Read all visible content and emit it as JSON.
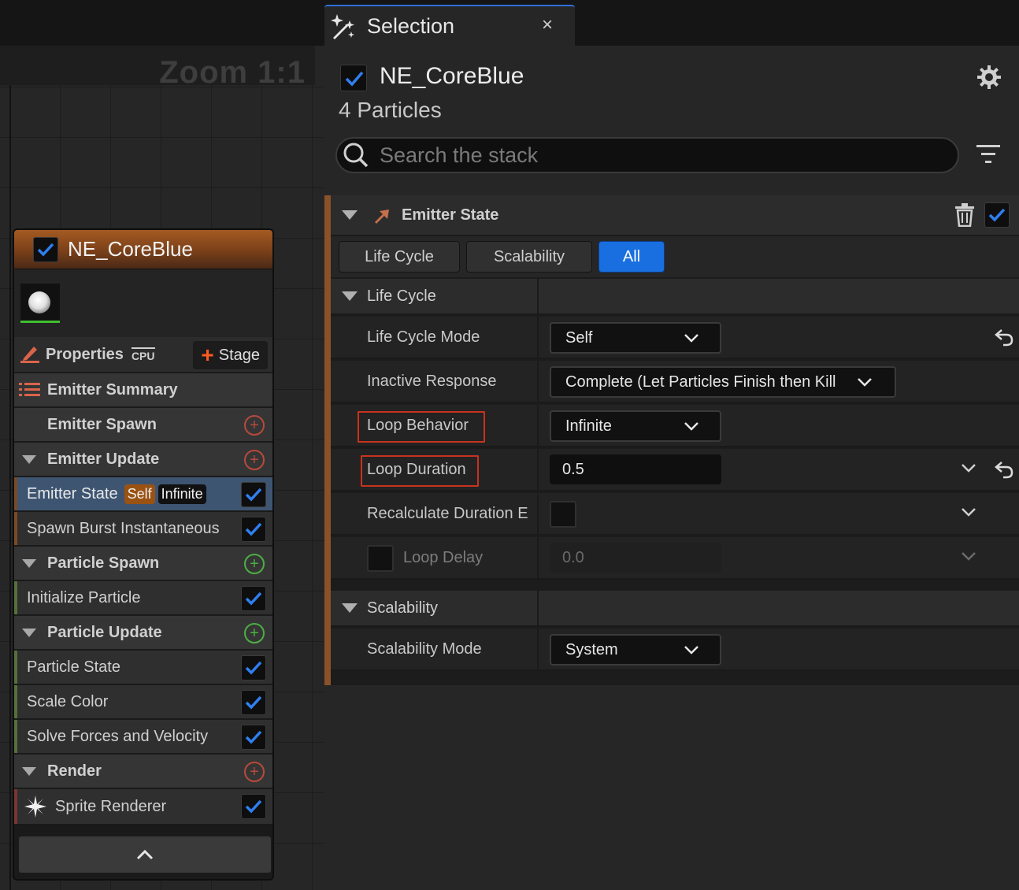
{
  "graph": {
    "zoom_label": "Zoom 1:1"
  },
  "node": {
    "title": "NE_CoreBlue",
    "properties_label": "Properties",
    "cpu_label": "CPU",
    "stage_label": "Stage",
    "rows": {
      "emitter_summary": "Emitter Summary",
      "emitter_spawn": "Emitter Spawn",
      "emitter_update": "Emitter Update",
      "emitter_state": "Emitter State",
      "badge_self": "Self",
      "badge_infinite": "Infinite",
      "spawn_burst": "Spawn Burst Instantaneous",
      "particle_spawn": "Particle Spawn",
      "initialize_particle": "Initialize Particle",
      "particle_update": "Particle Update",
      "particle_state": "Particle State",
      "scale_color": "Scale Color",
      "solve_forces": "Solve Forces and Velocity",
      "render": "Render",
      "sprite_renderer": "Sprite Renderer"
    }
  },
  "panel": {
    "tab_title": "Selection",
    "close_glyph": "×",
    "emitter_name": "NE_CoreBlue",
    "particle_count": "4 Particles",
    "search_placeholder": "Search the stack",
    "stack_title": "Emitter State",
    "filters": [
      "Life Cycle",
      "Scalability",
      "All"
    ],
    "active_filter": "All",
    "life_cycle": {
      "header": "Life Cycle",
      "mode_label": "Life Cycle Mode",
      "mode_value": "Self",
      "inactive_label": "Inactive Response",
      "inactive_value": "Complete (Let Particles Finish then Kill",
      "loop_behavior_label": "Loop Behavior",
      "loop_behavior_value": "Infinite",
      "loop_duration_label": "Loop Duration",
      "loop_duration_value": "0.5",
      "recalc_label": "Recalculate Duration E",
      "loop_delay_label": "Loop Delay",
      "loop_delay_value": "0.0"
    },
    "scalability": {
      "header": "Scalability",
      "mode_label": "Scalability Mode",
      "mode_value": "System"
    }
  },
  "colors": {
    "accent_blue": "#1a6fe0",
    "emitter_orange": "#8a5229",
    "highlight_red": "#c8321e",
    "add_red": "#b74a3b",
    "add_green": "#4caf42"
  },
  "icons": {
    "tab": "sparkle-wand-icon",
    "settings": "gear-icon",
    "search": "search-icon",
    "filter": "filter-icon",
    "delete": "trash-icon",
    "reset": "reset-arrow-icon",
    "expand": "chevron-down-icon",
    "collapse": "chevron-up-icon"
  }
}
